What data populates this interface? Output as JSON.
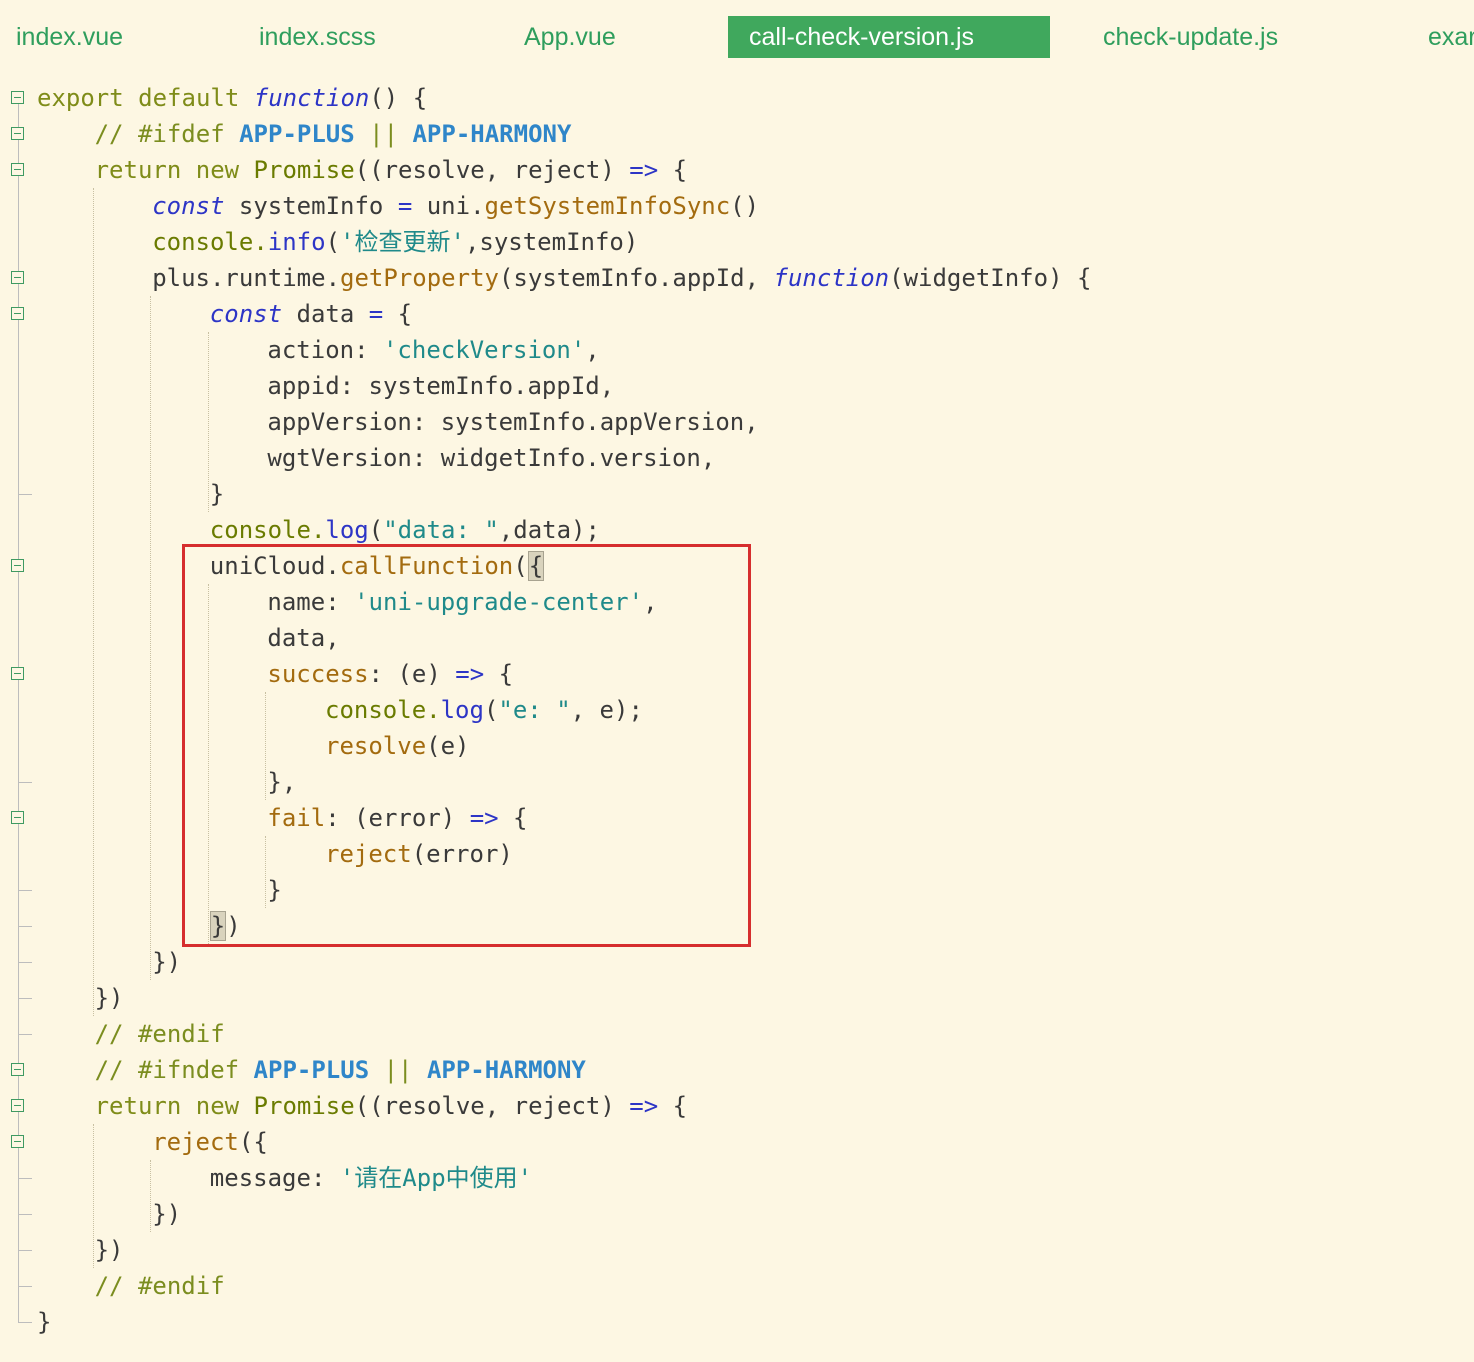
{
  "tabs": [
    {
      "label": "index.vue",
      "active": false
    },
    {
      "label": "index.scss",
      "active": false
    },
    {
      "label": "App.vue",
      "active": false
    },
    {
      "label": "call-check-version.js",
      "active": true
    },
    {
      "label": "check-update.js",
      "active": false
    },
    {
      "label": "exar",
      "active": false
    }
  ],
  "editor": {
    "lines": [
      {
        "tokens": [
          [
            "kw",
            "export default "
          ],
          [
            "it",
            "function"
          ],
          [
            "pl",
            "() {"
          ]
        ]
      },
      {
        "tokens": [
          [
            "cm",
            "// #ifdef "
          ],
          [
            "mac",
            "APP-PLUS"
          ],
          [
            "cm",
            " || "
          ],
          [
            "mac",
            "APP-HARMONY"
          ]
        ]
      },
      {
        "tokens": [
          [
            "kw",
            "return new "
          ],
          [
            "cls",
            "Promise"
          ],
          [
            "pl",
            "((resolve, reject) "
          ],
          [
            "op",
            "=>"
          ],
          [
            "pl",
            " {"
          ]
        ]
      },
      {
        "tokens": [
          [
            "it",
            "const"
          ],
          [
            "pl",
            " systemInfo "
          ],
          [
            "op",
            "="
          ],
          [
            "pl",
            " uni."
          ],
          [
            "fn",
            "getSystemInfoSync"
          ],
          [
            "pl",
            "()"
          ]
        ]
      },
      {
        "tokens": [
          [
            "obj",
            "console."
          ],
          [
            "op",
            "info"
          ],
          [
            "pl",
            "("
          ],
          [
            "str",
            "'检查更新'"
          ],
          [
            "pl",
            ",systemInfo)"
          ]
        ]
      },
      {
        "tokens": [
          [
            "pl",
            "plus.runtime."
          ],
          [
            "fn",
            "getProperty"
          ],
          [
            "pl",
            "(systemInfo.appId, "
          ],
          [
            "it",
            "function"
          ],
          [
            "pl",
            "(widgetInfo) {"
          ]
        ]
      },
      {
        "tokens": [
          [
            "it",
            "const"
          ],
          [
            "pl",
            " data "
          ],
          [
            "op",
            "="
          ],
          [
            "pl",
            " {"
          ]
        ]
      },
      {
        "tokens": [
          [
            "pl",
            "action: "
          ],
          [
            "str",
            "'checkVersion'"
          ],
          [
            "pl",
            ","
          ]
        ]
      },
      {
        "tokens": [
          [
            "pl",
            "appid: systemInfo.appId,"
          ]
        ]
      },
      {
        "tokens": [
          [
            "pl",
            "appVersion: systemInfo.appVersion,"
          ]
        ]
      },
      {
        "tokens": [
          [
            "pl",
            "wgtVersion: widgetInfo.version,"
          ]
        ]
      },
      {
        "tokens": [
          [
            "pl",
            "}"
          ]
        ]
      },
      {
        "tokens": [
          [
            "obj",
            "console."
          ],
          [
            "op",
            "log"
          ],
          [
            "pl",
            "("
          ],
          [
            "str",
            "\"data: \""
          ],
          [
            "pl",
            ",data);"
          ]
        ]
      },
      {
        "tokens": [
          [
            "pl",
            "uniCloud."
          ],
          [
            "fn",
            "callFunction"
          ],
          [
            "pl",
            "("
          ],
          [
            "brk",
            "{"
          ]
        ]
      },
      {
        "tokens": [
          [
            "pl",
            "name: "
          ],
          [
            "str",
            "'uni-upgrade-center'"
          ],
          [
            "pl",
            ","
          ]
        ]
      },
      {
        "tokens": [
          [
            "pl",
            "data,"
          ]
        ]
      },
      {
        "tokens": [
          [
            "sup",
            "success"
          ],
          [
            "pl",
            ": (e) "
          ],
          [
            "op",
            "=>"
          ],
          [
            "pl",
            " {"
          ]
        ]
      },
      {
        "tokens": [
          [
            "obj",
            "console."
          ],
          [
            "op",
            "log"
          ],
          [
            "pl",
            "("
          ],
          [
            "str",
            "\"e: \""
          ],
          [
            "pl",
            ", e);"
          ]
        ]
      },
      {
        "tokens": [
          [
            "fn",
            "resolve"
          ],
          [
            "pl",
            "(e)"
          ]
        ]
      },
      {
        "tokens": [
          [
            "pl",
            "},"
          ]
        ]
      },
      {
        "tokens": [
          [
            "sup",
            "fail"
          ],
          [
            "pl",
            ": (error) "
          ],
          [
            "op",
            "=>"
          ],
          [
            "pl",
            " {"
          ]
        ]
      },
      {
        "tokens": [
          [
            "fn",
            "reject"
          ],
          [
            "pl",
            "(error)"
          ]
        ]
      },
      {
        "tokens": [
          [
            "pl",
            "}"
          ]
        ]
      },
      {
        "tokens": [
          [
            "brk",
            "}"
          ],
          [
            "pl",
            ")"
          ]
        ]
      },
      {
        "tokens": [
          [
            "pl",
            "})"
          ]
        ]
      },
      {
        "tokens": [
          [
            "pl",
            "})"
          ]
        ]
      },
      {
        "tokens": [
          [
            "cm",
            "// #endif"
          ]
        ]
      },
      {
        "tokens": [
          [
            "cm",
            "// #ifndef "
          ],
          [
            "mac",
            "APP-PLUS"
          ],
          [
            "cm",
            " || "
          ],
          [
            "mac",
            "APP-HARMONY"
          ]
        ]
      },
      {
        "tokens": [
          [
            "kw",
            "return new "
          ],
          [
            "cls",
            "Promise"
          ],
          [
            "pl",
            "((resolve, reject) "
          ],
          [
            "op",
            "=>"
          ],
          [
            "pl",
            " {"
          ]
        ]
      },
      {
        "tokens": [
          [
            "fn",
            "reject"
          ],
          [
            "pl",
            "({"
          ]
        ]
      },
      {
        "tokens": [
          [
            "pl",
            "message: "
          ],
          [
            "str",
            "'请在App中使用'"
          ]
        ]
      },
      {
        "tokens": [
          [
            "pl",
            "})"
          ]
        ]
      },
      {
        "tokens": [
          [
            "pl",
            "})"
          ]
        ]
      },
      {
        "tokens": [
          [
            "cm",
            "// #endif"
          ]
        ]
      },
      {
        "tokens": [
          [
            "pl",
            "}"
          ]
        ]
      }
    ]
  }
}
